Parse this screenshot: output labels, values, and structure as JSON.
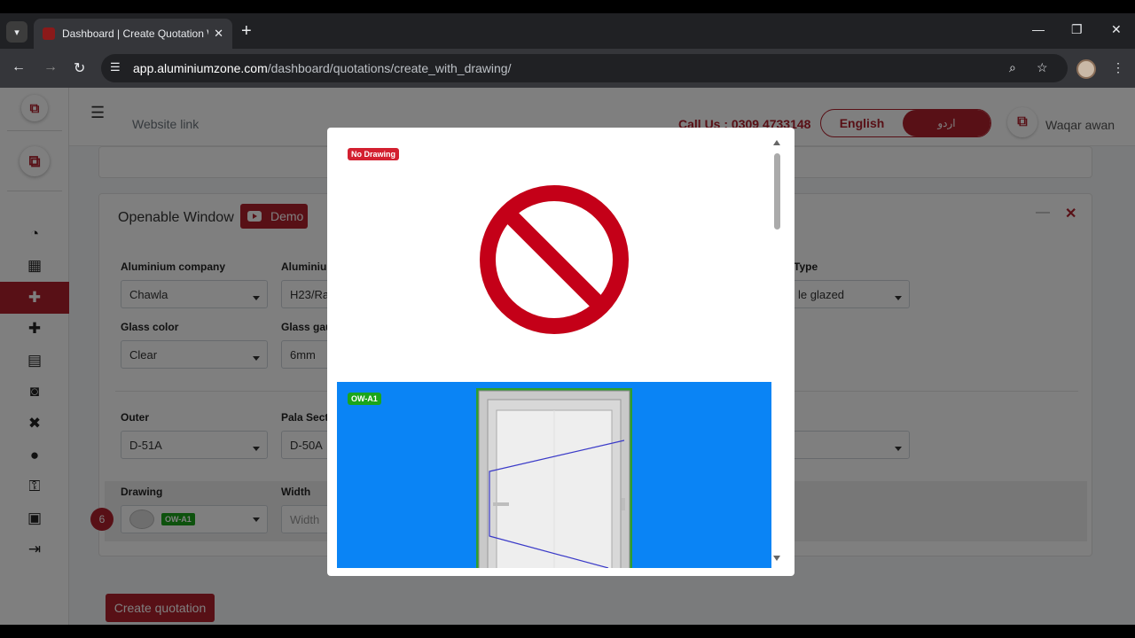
{
  "browser": {
    "tab_title": "Dashboard | Create Quotation W",
    "new_tab": "+",
    "url_host": "app.aluminiumzone.com",
    "url_path": "/dashboard/quotations/create_with_drawing/"
  },
  "topbar": {
    "website_link": "Website link",
    "call_us": "Call Us : 0309 4733148",
    "lang_en": "English",
    "lang_ur": "اردو",
    "user_name": "Waqar awan"
  },
  "card": {
    "title": "Openable Window",
    "demo_label": "Demo"
  },
  "form": {
    "aluminium_company_label": "Aluminium company",
    "aluminium_company_value": "Chawla",
    "aluminium_label_partial": "Aluminiu",
    "aluminium_value_partial": "H23/Ra",
    "type_label_partial": "Type",
    "type_value_partial": "le glazed",
    "glass_color_label": "Glass color",
    "glass_color_value": "Clear",
    "glass_gauge_label_partial": "Glass gau",
    "glass_gauge_value": "6mm",
    "outer_label": "Outer",
    "outer_value": "D-51A",
    "pala_label_partial": "Pala Sect",
    "pala_value": "D-50A",
    "drawing_label": "Drawing",
    "drawing_value": "OW-A1",
    "width_label": "Width",
    "width_placeholder": "Width",
    "row_number": "6",
    "create_button": "Create quotation"
  },
  "modal": {
    "no_drawing_badge": "No Drawing",
    "option_badge": "OW-A1"
  },
  "colors": {
    "brand": "#b1202c",
    "option_bg": "#0a84f5",
    "badge_green": "#1ba51b"
  }
}
